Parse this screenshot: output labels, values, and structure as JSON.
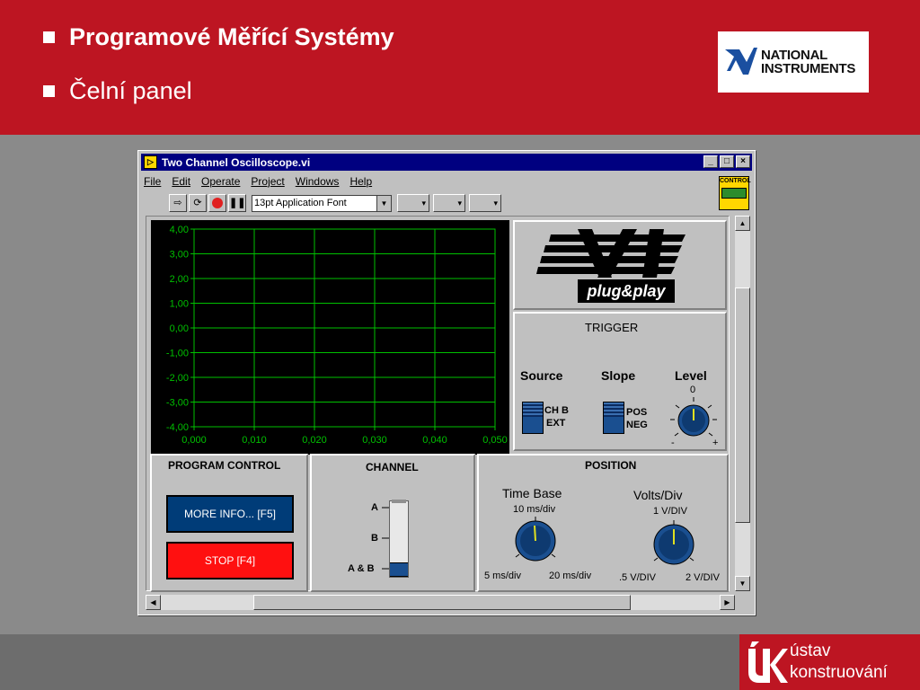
{
  "slide": {
    "title": "Programové Měřící Systémy",
    "subtitle": "Čelní panel",
    "ni_logo_line1": "NATIONAL",
    "ni_logo_line2": "INSTRUMENTS",
    "footer_logo_line1": "ústav",
    "footer_logo_line2": "konstruování"
  },
  "window": {
    "title": "Two Channel Oscilloscope.vi",
    "minimize": "_",
    "maximize": "□",
    "close": "×",
    "menu": [
      "File",
      "Edit",
      "Operate",
      "Project",
      "Windows",
      "Help"
    ],
    "font_selector": "13pt Application Font",
    "control_icon_label": "CONTROL"
  },
  "graph": {
    "y_ticks": [
      "4,00",
      "3,00",
      "2,00",
      "1,00",
      "0,00",
      "-1,00",
      "-2,00",
      "-3,00",
      "-4,00"
    ],
    "x_ticks": [
      "0,000",
      "0,010",
      "0,020",
      "0,030",
      "0,040",
      "0,050"
    ],
    "grid_color": "#00c000",
    "background": "#000000"
  },
  "vxi": {
    "logo_text": "VXI",
    "logo_sub": "plug&play"
  },
  "trigger": {
    "title": "TRIGGER",
    "source_label": "Source",
    "slope_label": "Slope",
    "level_label": "Level",
    "source_opt1": "CH B",
    "source_opt2": "EXT",
    "slope_opt1": "POS",
    "slope_opt2": "NEG",
    "level_zero": "0",
    "level_minus": "-",
    "level_plus": "+"
  },
  "program_control": {
    "title": "PROGRAM CONTROL",
    "more_info": "MORE INFO... [F5]",
    "stop": "STOP [F4]",
    "more_color": "#003c78",
    "stop_color": "#ff1010"
  },
  "channel": {
    "title": "CHANNEL",
    "opt_a": "A",
    "opt_b": "B",
    "opt_ab": "A & B",
    "selected": "A & B"
  },
  "position": {
    "title": "POSITION",
    "timebase_label": "Time Base",
    "timebase_value": "10 ms/div",
    "timebase_min": "5 ms/div",
    "timebase_max": "20 ms/div",
    "volts_label": "Volts/Div",
    "volts_value": "1 V/DIV",
    "volts_min": ".5 V/DIV",
    "volts_max": "2 V/DIV"
  },
  "colors": {
    "slide_red": "#bd1522",
    "titlebar": "#000080",
    "panel_gray": "#c0c0c0"
  }
}
